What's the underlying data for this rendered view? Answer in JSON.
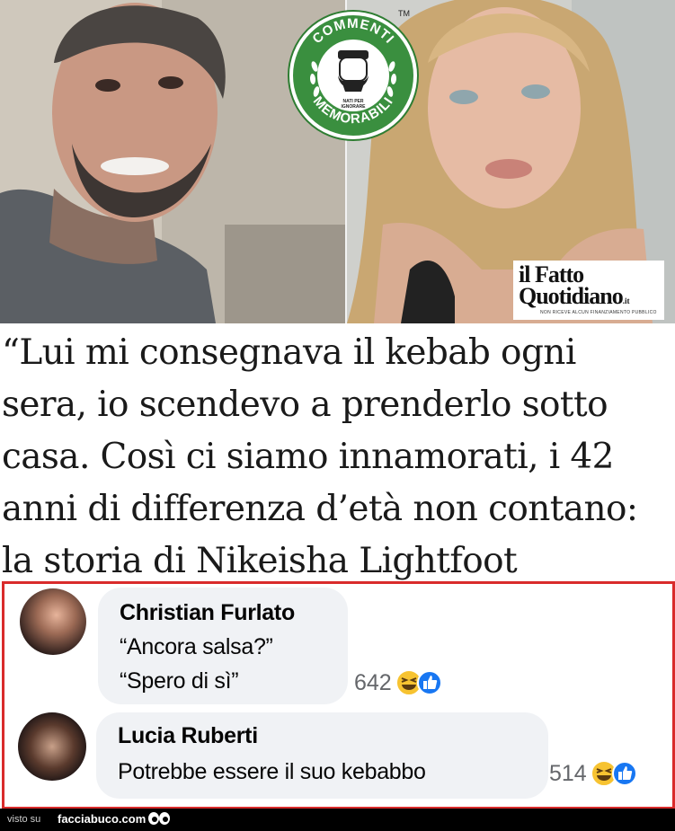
{
  "image": {
    "badge": {
      "top_text": "COMMENTI",
      "bottom_text": "MEMORABILI",
      "small_text_1": "NATI PER",
      "small_text_2": "IGNORARE",
      "trademark": "TM"
    },
    "logo": {
      "line1": "il Fatto",
      "line2": "Quotidiano",
      "suffix": ".it",
      "tagline": "NON RICEVE ALCUN FINANZIAMENTO PUBBLICO"
    }
  },
  "headline": {
    "line1": "“Lui mi consegnava il kebab ogni",
    "line2": "sera, io scendevo a prenderlo sotto",
    "line3": "casa. Così ci siamo innamorati, i 42",
    "line4": "anni di differenza d’età non contano:",
    "line5": "la storia di Nikeisha Lightfoot"
  },
  "comments": [
    {
      "author": "Christian Furlato",
      "line1": "“Ancora salsa?”",
      "line2": "“Spero di sì”",
      "reaction_count": "642"
    },
    {
      "author": "Lucia Ruberti",
      "line1": "Potrebbe essere il suo kebabbo",
      "reaction_count": "514"
    }
  ],
  "footer": {
    "prefix": "visto su",
    "site": "facciabuco.com"
  },
  "colors": {
    "frame": "#d92b2b",
    "badge_green": "#3a8f3f",
    "bubble": "#f0f2f5",
    "like_blue": "#1877f2",
    "haha_yellow": "#f7c331"
  }
}
